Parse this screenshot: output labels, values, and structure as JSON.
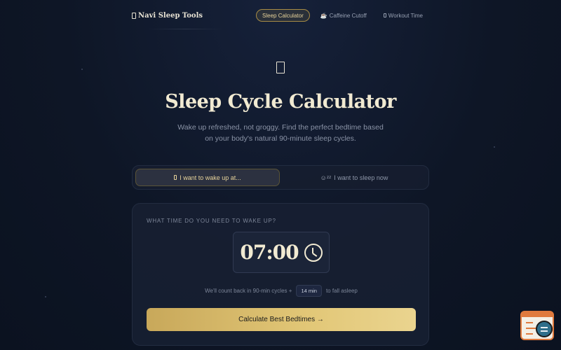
{
  "nav": {
    "brand": "Navi Sleep Tools",
    "links": [
      {
        "label": "Sleep Calculator",
        "icon": "none"
      },
      {
        "label": "Caffeine Cutoff",
        "icon": "coffee-icon"
      },
      {
        "label": "Workout Time",
        "icon": "box-icon"
      }
    ]
  },
  "hero": {
    "title": "Sleep Cycle Calculator",
    "subtitle": "Wake up refreshed, not groggy. Find the perfect bedtime based on your body's natural 90-minute sleep cycles."
  },
  "toggle": {
    "wake_label": "I want to wake up at...",
    "sleep_label": "I want to sleep now"
  },
  "card": {
    "label": "WHAT TIME DO YOU NEED TO WAKE UP?",
    "time": "07:00",
    "note_before": "We'll count back in 90-min cycles +",
    "fall_asleep_value": "14 min",
    "note_after": "to fall asleep",
    "cta": "Calculate Best Bedtimes →"
  },
  "colors": {
    "accent": "#c8a85a",
    "background": "#0e1626"
  }
}
